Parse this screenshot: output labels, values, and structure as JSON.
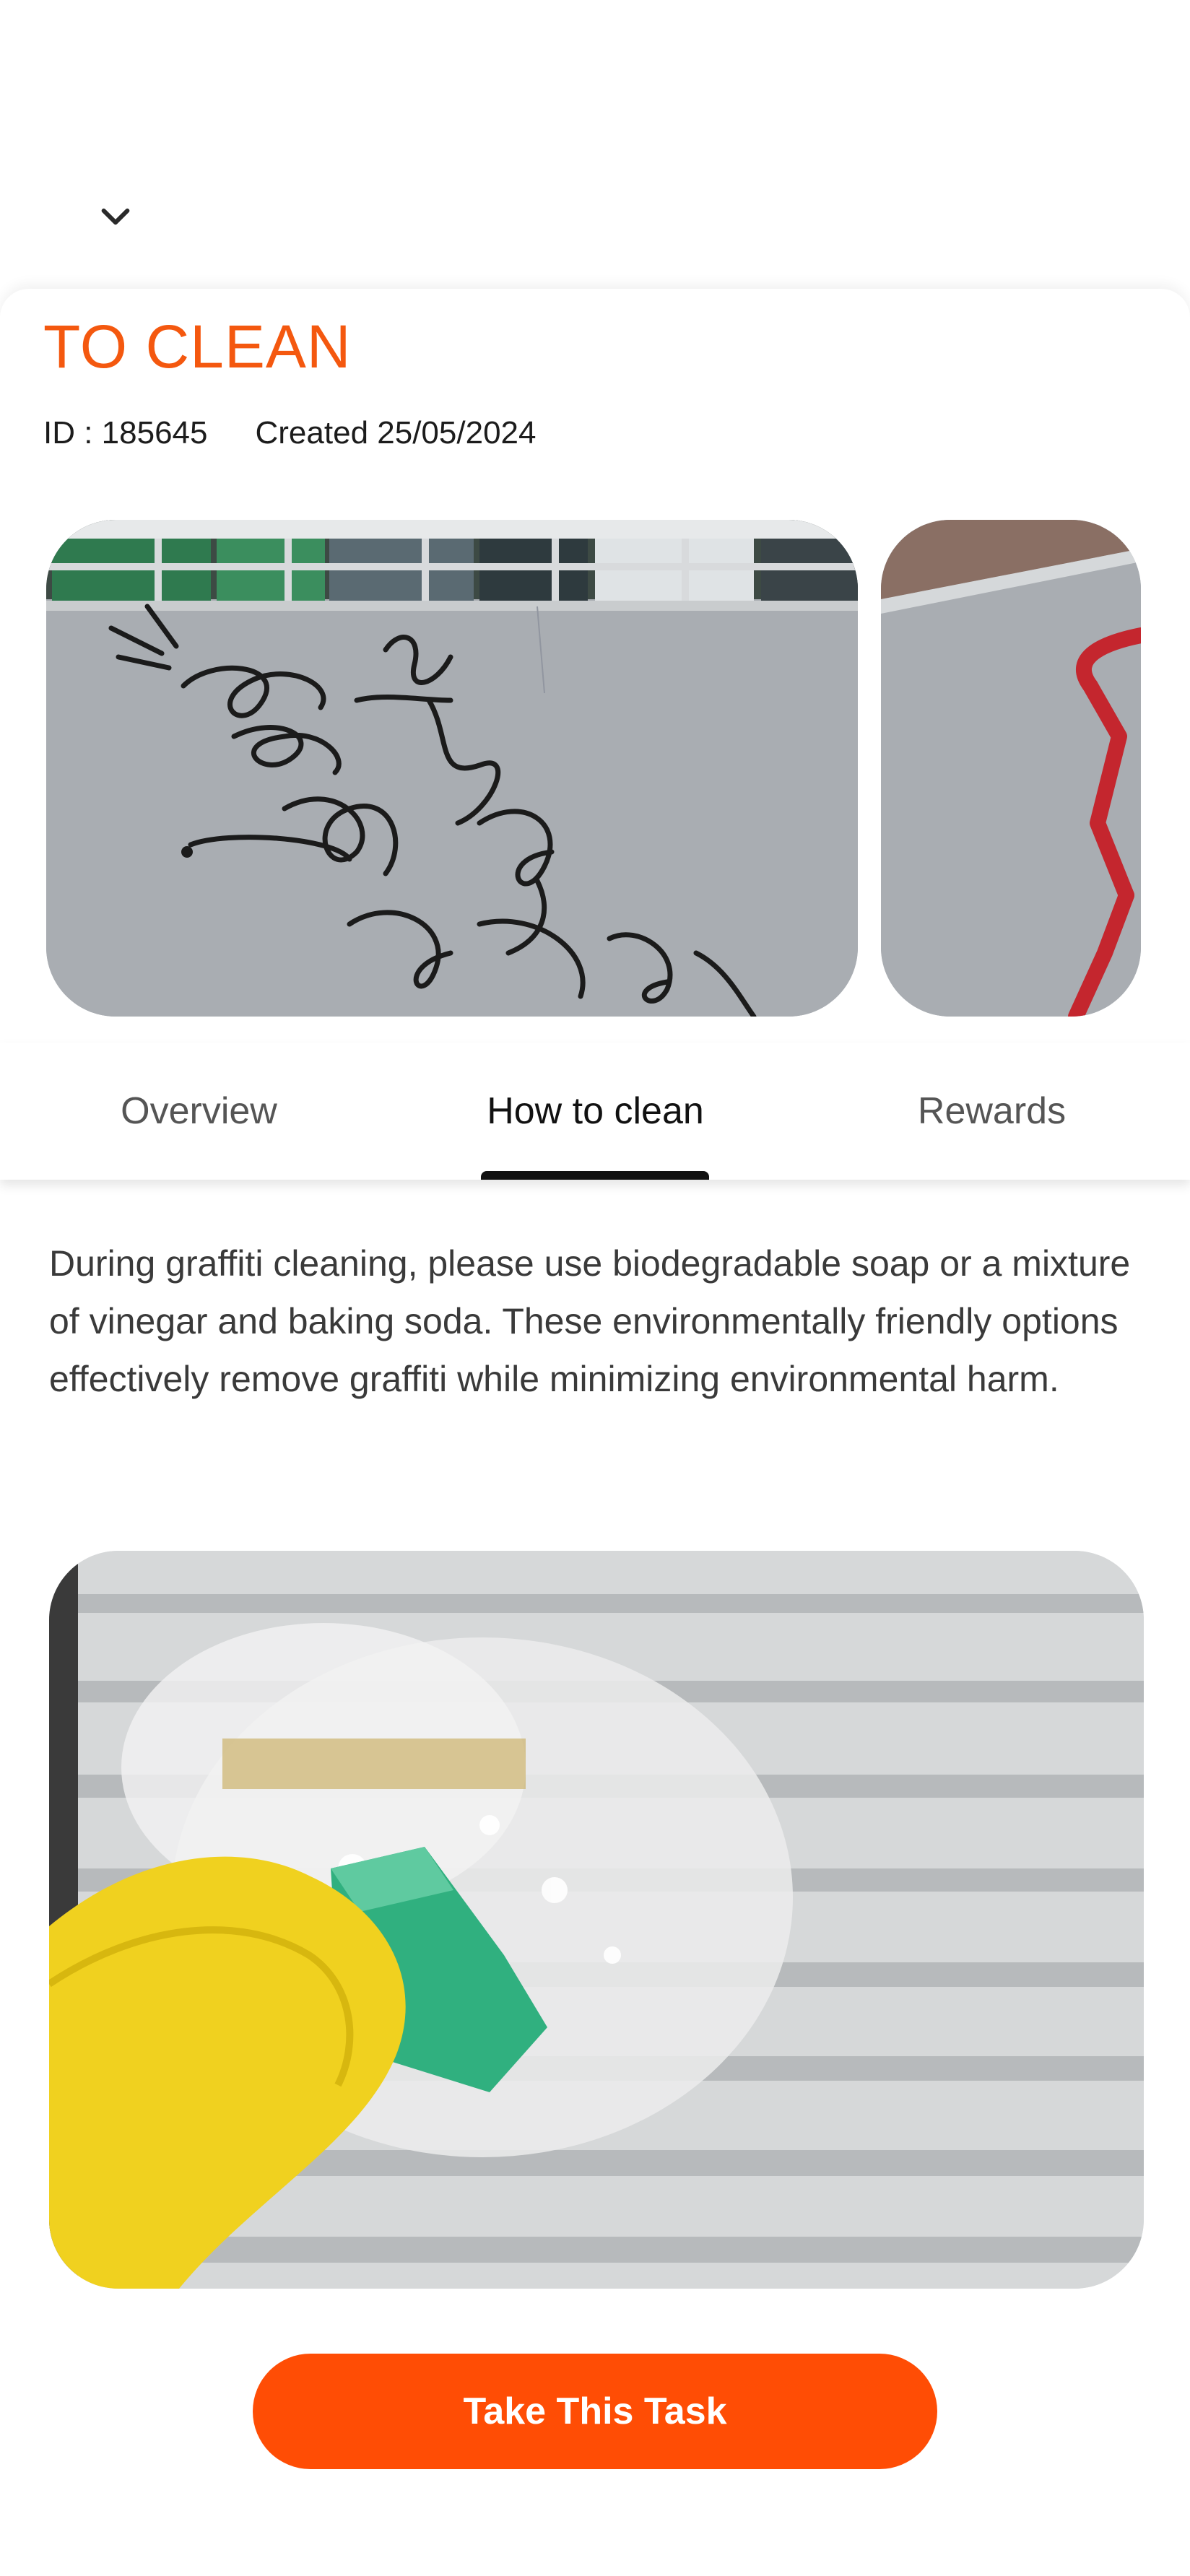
{
  "header": {
    "collapse_icon": "chevron-down-icon"
  },
  "task": {
    "status": "TO CLEAN",
    "id_label": "ID : 185645",
    "created_label": "Created 25/05/2024"
  },
  "tabs": [
    {
      "label": "Overview",
      "active": false
    },
    {
      "label": "How to clean",
      "active": true
    },
    {
      "label": "Rewards",
      "active": false
    }
  ],
  "how_to_clean": {
    "text": "During graffiti cleaning, please use biodegradable soap or a mixture of vinegar and baking soda. These environmentally friendly options effectively remove graffiti while minimizing environmental harm."
  },
  "cta": {
    "label": "Take This Task"
  },
  "colors": {
    "accent": "#F4580F",
    "button": "#FF4D05",
    "text_dark": "#111111",
    "text_muted": "#555555"
  }
}
